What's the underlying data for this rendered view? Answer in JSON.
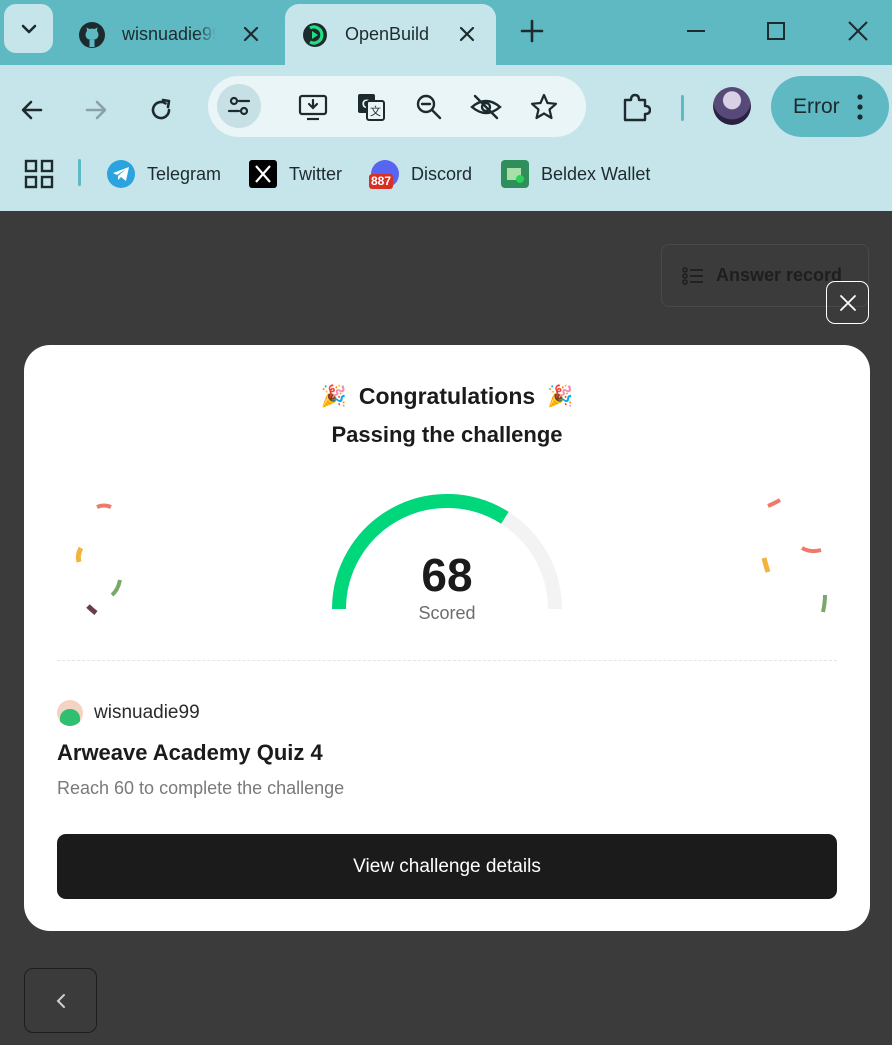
{
  "browser": {
    "tabs": [
      {
        "title": "wisnuadie99",
        "icon": "github-icon",
        "active": false
      },
      {
        "title": "OpenBuild",
        "icon": "openbuild-icon",
        "active": true
      }
    ],
    "profile_status": "Error",
    "bookmarks": [
      {
        "label": "Telegram",
        "icon": "telegram-icon"
      },
      {
        "label": "Twitter",
        "icon": "x-icon"
      },
      {
        "label": "Discord",
        "icon": "discord-icon",
        "badge": "887"
      },
      {
        "label": "Beldex Wallet",
        "icon": "beldex-wallet-icon"
      }
    ]
  },
  "page": {
    "answer_record_label": "Answer record"
  },
  "modal": {
    "congrats_emoji": "🎉",
    "title": "Congratulations",
    "subtitle": "Passing the challenge",
    "score": "68",
    "score_label": "Scored",
    "score_fraction": 0.68,
    "username": "wisnuadie99",
    "quiz_title": "Arweave Academy Quiz 4",
    "quiz_description": "Reach 60 to complete the challenge",
    "view_button_label": "View challenge details"
  },
  "colors": {
    "tabstrip": "#5fb9c3",
    "toolbar": "#c6e5ea",
    "gauge_fill": "#00d67a",
    "gauge_track": "#f3f3f3",
    "confetti": [
      "#f07a6a",
      "#f2b43c",
      "#79a86a",
      "#6a3b4e"
    ]
  }
}
